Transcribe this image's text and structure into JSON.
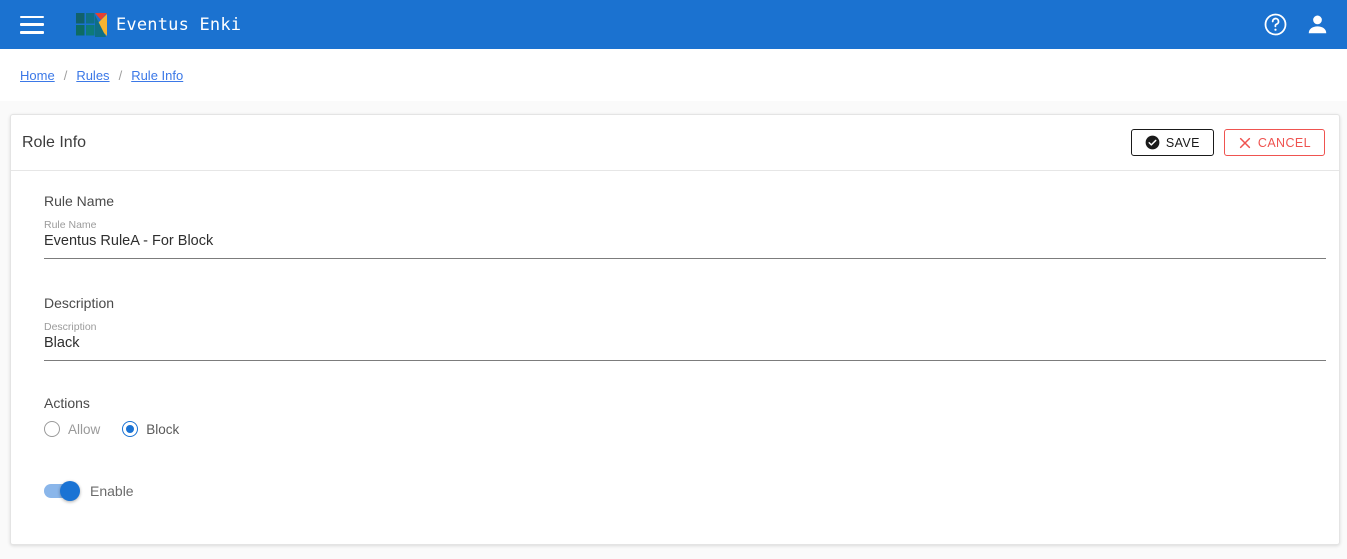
{
  "appbar": {
    "menu_icon": "hamburger-menu-icon",
    "logo_icon": "eventus-enki-logo-icon",
    "brand": "Eventus Enki",
    "help_icon": "help-circle-icon",
    "account_icon": "account-person-icon",
    "background_color": "#1b72d0"
  },
  "breadcrumb": {
    "items": [
      {
        "label": "Home"
      },
      {
        "label": "Rules"
      },
      {
        "label": "Rule Info"
      }
    ],
    "separator": "/",
    "link_color": "#3b78e7"
  },
  "card": {
    "title": "Role Info",
    "buttons": {
      "save": {
        "label": "SAVE",
        "icon": "check-circle-icon",
        "color": "#1a1a1a"
      },
      "cancel": {
        "label": "CANCEL",
        "icon": "close-x-icon",
        "color": "#ef5350"
      }
    }
  },
  "form": {
    "rule_name": {
      "section_label": "Rule Name",
      "float_label": "Rule Name",
      "value": "Eventus RuleA - For Block",
      "placeholder": "Rule Name"
    },
    "description": {
      "section_label": "Description",
      "float_label": "Description",
      "value": "Black",
      "placeholder": "Description"
    },
    "actions": {
      "section_label": "Actions",
      "options": [
        {
          "label": "Allow",
          "selected": false
        },
        {
          "label": "Block",
          "selected": true
        }
      ],
      "selected_color": "#1a73d4"
    },
    "enable_toggle": {
      "label": "Enable",
      "state": "on",
      "color": "#1a73d4"
    }
  }
}
